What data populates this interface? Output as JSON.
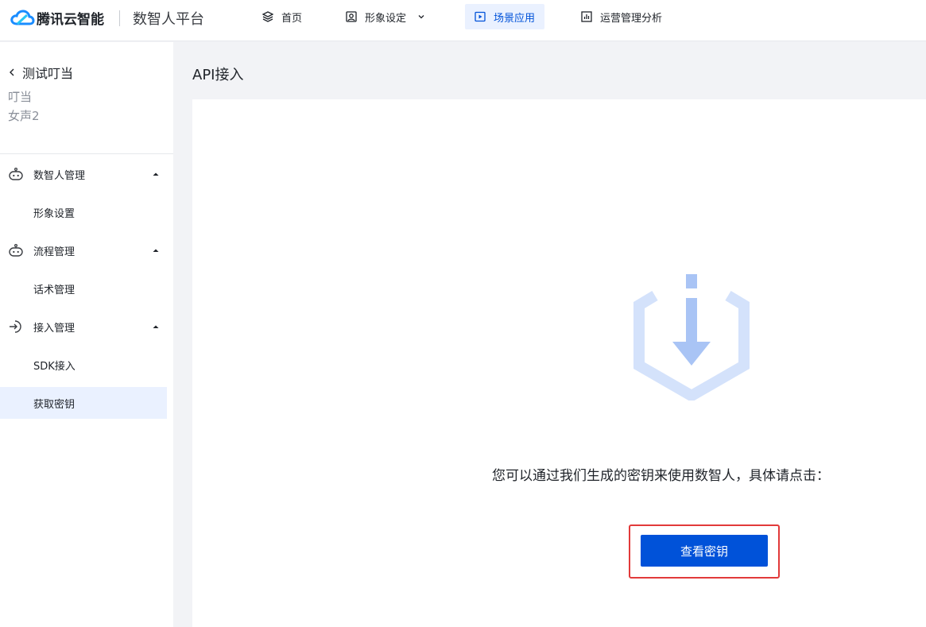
{
  "brand": {
    "logo_text": "腾讯云智能",
    "platform_name": "数智人平台"
  },
  "nav": {
    "items": [
      {
        "label": "首页",
        "icon": "layers-icon"
      },
      {
        "label": "形象设定",
        "icon": "portrait-icon"
      },
      {
        "label": "场景应用",
        "icon": "play-square-icon"
      },
      {
        "label": "运营管理分析",
        "icon": "bar-chart-icon"
      }
    ],
    "active": "场景应用"
  },
  "sidebar": {
    "back_label": "测试叮当",
    "subtitle_line1": "叮当",
    "subtitle_line2": "女声2",
    "groups": [
      {
        "label": "数智人管理",
        "icon": "robot-icon",
        "children": [
          "形象设置"
        ]
      },
      {
        "label": "流程管理",
        "icon": "robot-icon",
        "children": [
          "话术管理"
        ]
      },
      {
        "label": "接入管理",
        "icon": "login-icon",
        "children": [
          "SDK接入",
          "获取密钥"
        ]
      }
    ],
    "active_item": "获取密钥"
  },
  "main": {
    "title": "API接入",
    "description": "您可以通过我们生成的密钥来使用数智人，具体请点击：",
    "button_label": "查看密钥"
  },
  "colors": {
    "primary": "#0052d9",
    "active_bg": "#eaf1ff",
    "highlight": "#e23a3a",
    "illustration": "#a9c4f5"
  }
}
